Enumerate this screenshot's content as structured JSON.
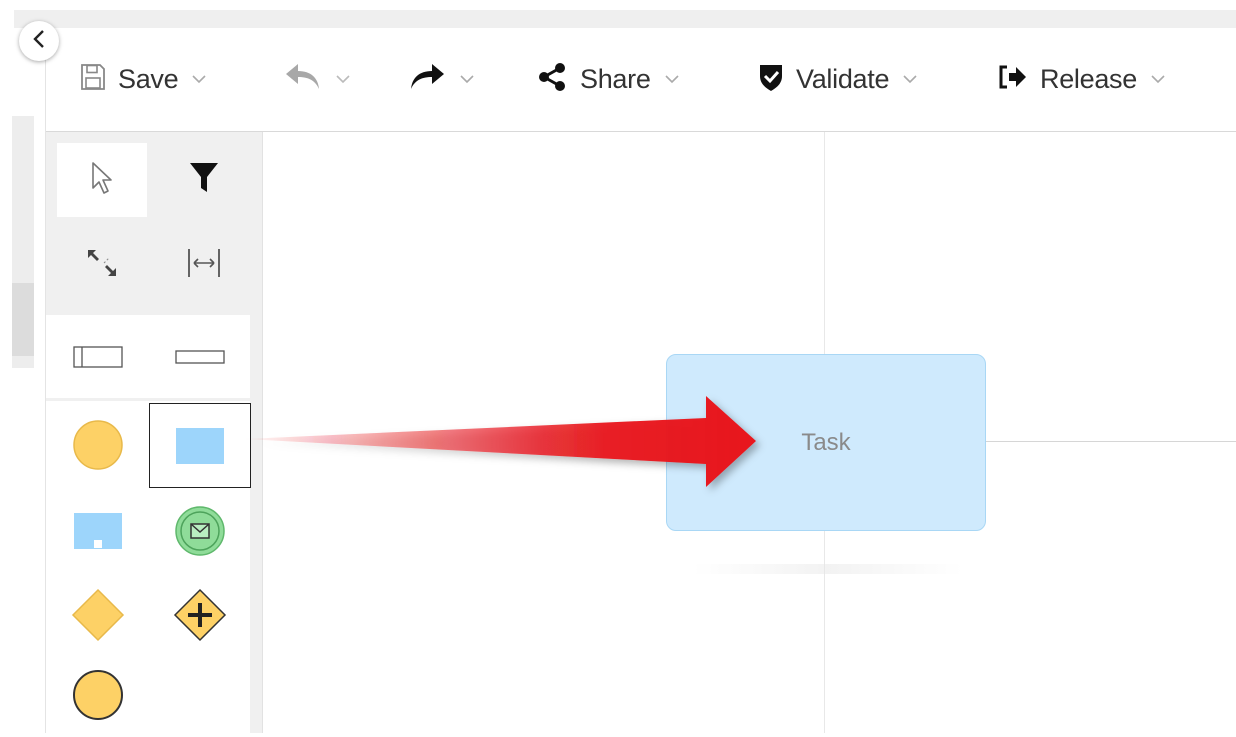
{
  "toolbar": {
    "save_label": "Save",
    "share_label": "Share",
    "validate_label": "Validate",
    "release_label": "Release"
  },
  "palette": {
    "tools": [
      "pointer-tool",
      "filter-tool",
      "resize-tool",
      "space-tool"
    ],
    "shapes": [
      "pool-shape",
      "lane-shape",
      "start-event",
      "task",
      "subprocess",
      "message-event",
      "gateway",
      "parallel-gateway",
      "end-event"
    ]
  },
  "canvas": {
    "task_label": "Task"
  },
  "colors": {
    "accent_red": "#e8141b",
    "task_fill": "#cfeafd",
    "event_fill": "#fdd166",
    "message_fill": "#8fdc99"
  }
}
